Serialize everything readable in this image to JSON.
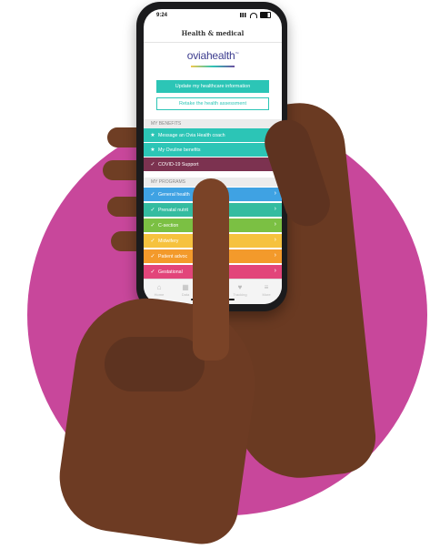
{
  "status_bar": {
    "time": "9:24"
  },
  "header": {
    "title": "Health & medical"
  },
  "logo": {
    "text": "oviahealth",
    "mark": "™"
  },
  "actions": {
    "primary": "Update my healthcare information",
    "secondary": "Retake the health assessment"
  },
  "benefits": {
    "heading": "MY BENEFITS",
    "items": [
      {
        "label": "Message an Ovia Health coach",
        "icon": "star-icon",
        "color": "#2cc5b6"
      },
      {
        "label": "My Ovuline benefits",
        "icon": "star-icon",
        "color": "#2cc5b6"
      },
      {
        "label": "COVID-19 Support",
        "icon": "check-icon",
        "color": "#7c3250"
      }
    ]
  },
  "programs": {
    "heading": "MY PROGRAMS",
    "items": [
      {
        "label": "General health",
        "icon": "check-icon",
        "color": "#3fa2e3"
      },
      {
        "label": "Prenatal nutrit",
        "icon": "check-icon",
        "color": "#34bca0"
      },
      {
        "label": "C-section",
        "icon": "check-icon",
        "color": "#7bc043"
      },
      {
        "label": "Midwifery",
        "icon": "check-icon",
        "color": "#f6c23e"
      },
      {
        "label": "Patient advoc",
        "icon": "check-icon",
        "color": "#f39a2b"
      },
      {
        "label": "Gestational",
        "icon": "check-icon",
        "color": "#e2457a"
      }
    ]
  },
  "tabs": [
    {
      "label": "Home",
      "icon": "home-icon"
    },
    {
      "label": "Data",
      "icon": "calendar-icon"
    },
    {
      "label": "",
      "icon": "chat-icon"
    },
    {
      "label": "Tracking",
      "icon": "heart-icon"
    },
    {
      "label": "More",
      "icon": "menu-icon"
    }
  ],
  "colors": {
    "background_circle": "#c8479b",
    "accent": "#2cc5b6"
  }
}
